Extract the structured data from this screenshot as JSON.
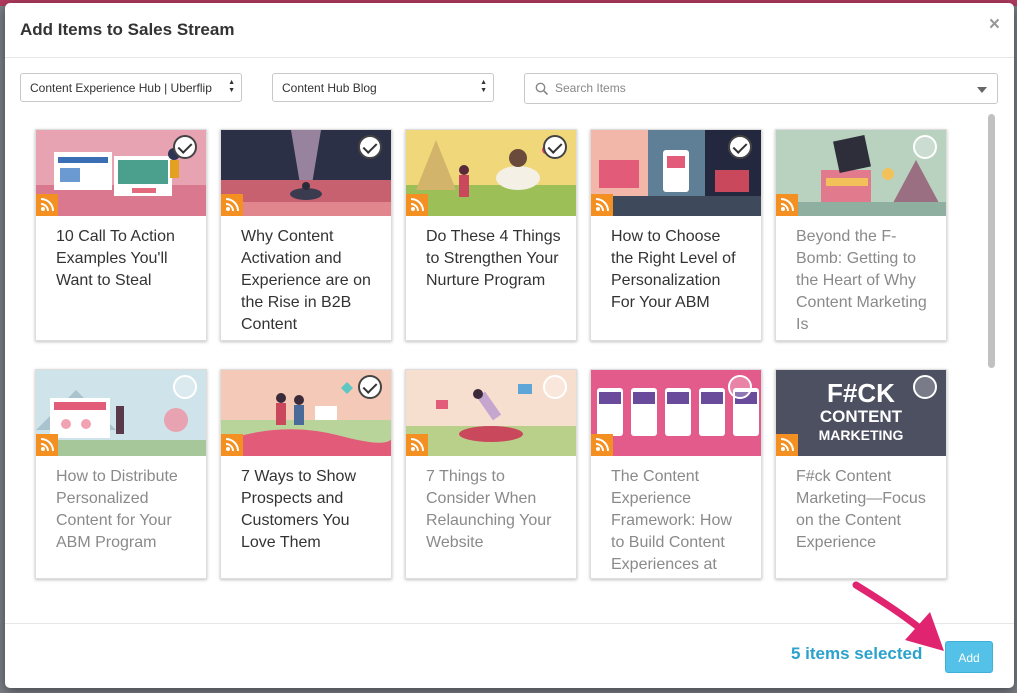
{
  "modal": {
    "title": "Add Items to Sales Stream",
    "close_symbol": "×"
  },
  "filters": {
    "hub_select": "Content Experience Hub | Uberflip",
    "stream_select": "Content Hub Blog",
    "search_placeholder": "Search Items"
  },
  "items": [
    {
      "title": "10 Call To Action Examples You'll Want to Steal",
      "selected": true
    },
    {
      "title": "Why Content Activation and Experience are on the Rise in B2B Content",
      "selected": true
    },
    {
      "title": "Do These 4 Things to Strengthen Your Nurture Program",
      "selected": true
    },
    {
      "title": "How to Choose the Right Level of Personalization For Your ABM",
      "selected": true
    },
    {
      "title": "Beyond the F-Bomb: Getting to the Heart of Why Content Marketing Is",
      "selected": false
    },
    {
      "title": "How to Distribute Personalized Content for Your ABM Program",
      "selected": false
    },
    {
      "title": "7 Ways to Show Prospects and Customers You Love Them",
      "selected": true
    },
    {
      "title": "7 Things to Consider When Relaunching Your Website",
      "selected": false
    },
    {
      "title": "The Content Experience Framework: How to Build Content Experiences at",
      "selected": false
    },
    {
      "title": "F#ck Content Marketing—Focus on the Content Experience",
      "selected": false
    }
  ],
  "thumbnail_texts": {
    "item10_line1": "F#CK",
    "item10_line2": "CONTENT",
    "item10_line3": "MARKETING"
  },
  "footer": {
    "selected_count_text": "5 items selected",
    "add_label": "Add"
  },
  "colors": {
    "accent": "#2ba1cc",
    "add_button": "#53c1e8",
    "rss_badge": "#f39021",
    "annotation_arrow": "#e0246f"
  },
  "icons": {
    "close": "close-icon",
    "search": "search-icon",
    "rss": "rss-icon",
    "check": "checkmark-icon"
  }
}
